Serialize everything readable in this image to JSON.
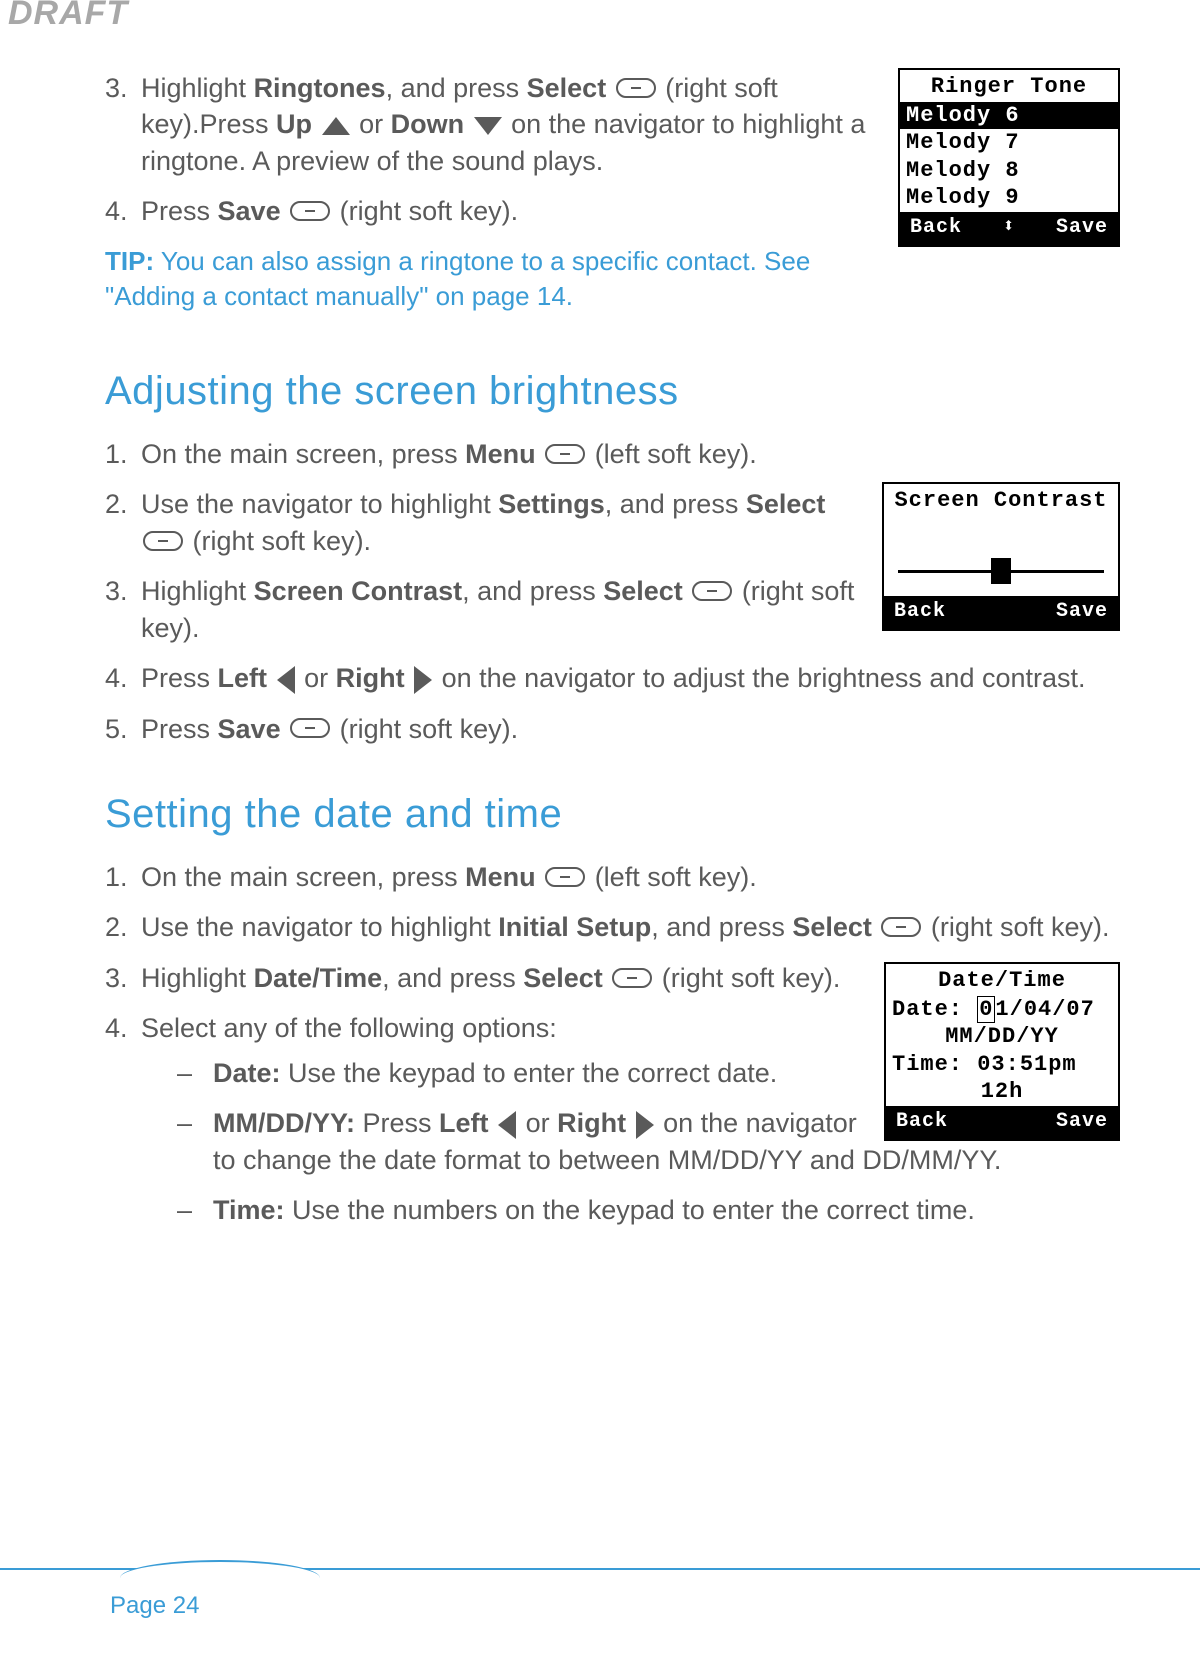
{
  "draft_label": "DRAFT",
  "sections": {
    "ringtone": {
      "step3_a": "Highlight ",
      "step3_b": "Ringtones",
      "step3_c": ", and press ",
      "step3_d": "Select",
      "step3_e": " (right soft key).Press ",
      "step3_f": "Up",
      "step3_g": " or ",
      "step3_h": "Down",
      "step3_i": " on the navigator to highlight a ringtone. A preview of the sound plays.",
      "step4_a": "Press ",
      "step4_b": "Save",
      "step4_c": " (right soft key)."
    },
    "tip": {
      "label": "TIP:",
      "text": " You can also assign a ringtone to a specific contact. See \"Adding a contact manually\" on page 14."
    },
    "brightness": {
      "heading": "Adjusting the screen brightness",
      "s1_a": "On the main screen, press ",
      "s1_b": "Menu",
      "s1_c": " (left soft key).",
      "s2_a": "Use the navigator to highlight ",
      "s2_b": "Settings",
      "s2_c": ", and press ",
      "s2_d": "Select",
      "s2_e": " (right soft key).",
      "s3_a": "Highlight ",
      "s3_b": "Screen Contrast",
      "s3_c": ", and press ",
      "s3_d": "Select",
      "s3_e": " (right soft key).",
      "s4_a": "Press ",
      "s4_b": "Left",
      "s4_c": " or ",
      "s4_d": "Right",
      "s4_e": " on the navigator to adjust the brightness and contrast.",
      "s5_a": "Press ",
      "s5_b": "Save",
      "s5_c": "  (right soft key)."
    },
    "datetime": {
      "heading": "Setting the date and time",
      "s1_a": "On the main screen, press ",
      "s1_b": "Menu",
      "s1_c": " (left soft key).",
      "s2_a": "Use the navigator to highlight ",
      "s2_b": "Initial Setup",
      "s2_c": ", and press ",
      "s2_d": "Select",
      "s2_e": " (right soft key).",
      "s3_a": "Highlight ",
      "s3_b": "Date/Time",
      "s3_c": ", and press ",
      "s3_d": "Select",
      "s3_e": " (right soft key).",
      "s4": "Select any of the following options:",
      "sub_date_b": "Date:",
      "sub_date_t": " Use the keypad to enter the correct date.",
      "sub_fmt_b": "MM/DD/YY:",
      "sub_fmt_t1": " Press ",
      "sub_fmt_left": "Left",
      "sub_fmt_or": " or ",
      "sub_fmt_right": "Right",
      "sub_fmt_t2": " on the navigator to change the date format to between MM/DD/YY and DD/MM/YY.",
      "sub_time_b": "Time:",
      "sub_time_t": " Use the numbers on the keypad to enter the correct time."
    }
  },
  "screens": {
    "ringer": {
      "title": "Ringer Tone",
      "items": [
        "Melody 6",
        "Melody 7",
        "Melody 8",
        "Melody 9"
      ],
      "back": "Back",
      "save": "Save",
      "mid": "⬍"
    },
    "contrast": {
      "title": "Screen Contrast",
      "back": "Back",
      "save": "Save"
    },
    "datetime": {
      "title": "Date/Time",
      "date_label": "Date: ",
      "date_value": "01/04/07",
      "format": "MM/DD/YY",
      "time_label": "Time: ",
      "time_value": "03:51pm",
      "mode": "12h",
      "back": "Back",
      "save": "Save"
    }
  },
  "page_number": "Page 24"
}
